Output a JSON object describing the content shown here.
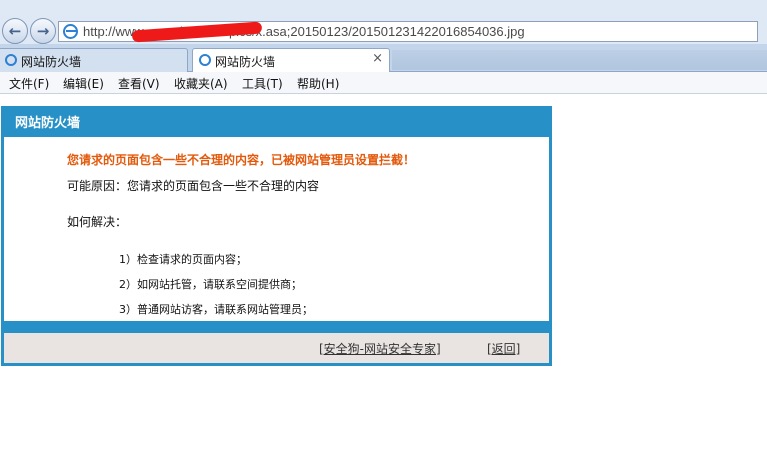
{
  "browser": {
    "url": "http://www.           .com/product/pics/x.asa;20150123/2015012314220168540​36.jpg",
    "tabs": [
      {
        "label": "网站防火墙",
        "active": false
      },
      {
        "label": "网站防火墙",
        "active": true,
        "close": "×"
      }
    ],
    "back_icon": "←",
    "forward_icon": "→"
  },
  "menu": {
    "items": [
      "文件(F)",
      "编辑(E)",
      "查看(V)",
      "收藏夹(A)",
      "工具(T)",
      "帮助(H)"
    ]
  },
  "firewall": {
    "title": "网站防火墙",
    "warning": "您请求的页面包含一些不合理的内容，已被网站管理员设置拦截！",
    "reason": "可能原因：您请求的页面包含一些不合理的内容",
    "how_label": "如何解决：",
    "steps": [
      "1）检查请求的页面内容；",
      "2）如网站托管，请联系空间提供商；",
      "3）普通网站访客，请联系网站管理员；"
    ],
    "footer_links": [
      "[安全狗-网站安全专家]",
      "[返回]"
    ]
  },
  "colors": {
    "panel_blue": "#2791c7",
    "warning_orange": "#e35a0c",
    "footer_bg": "#e9e4e2",
    "redaction": "#ee1a1a"
  }
}
